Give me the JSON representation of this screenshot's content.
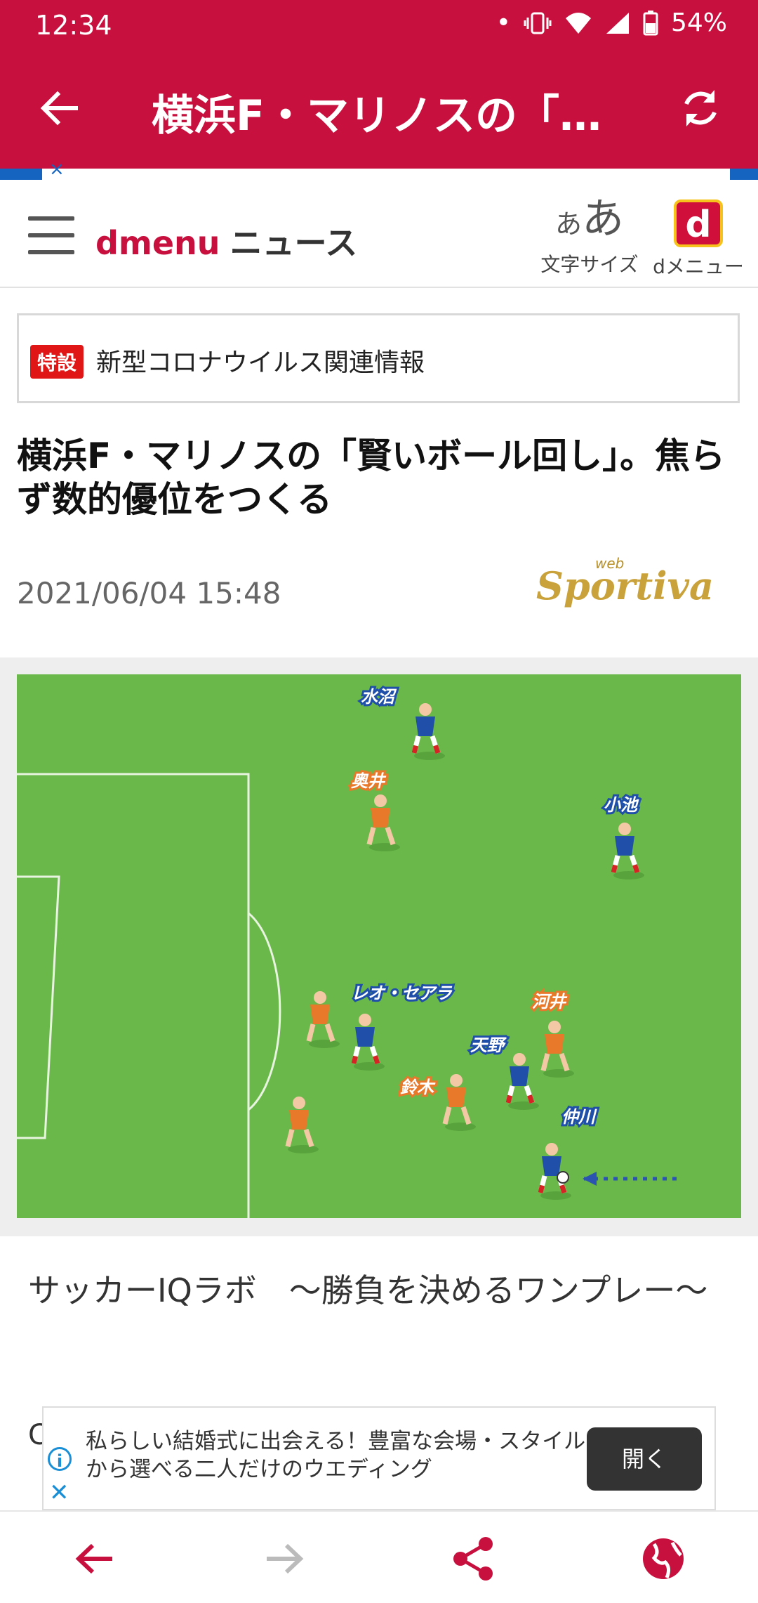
{
  "status_bar": {
    "time": "12:34",
    "battery": "54%",
    "icons": [
      "dot-icon",
      "vibrate-icon",
      "wifi-icon",
      "signal-icon",
      "battery-icon"
    ]
  },
  "app_bar": {
    "title": "横浜F・マリノスの「賢...",
    "back_icon": "back-arrow-icon",
    "refresh_icon": "refresh-icon"
  },
  "header": {
    "logo_d": "dmenu",
    "logo_news": "ニュース",
    "fontsize_glyph_small": "あ",
    "fontsize_glyph_large": "あ",
    "fontsize_label": "文字サイズ",
    "dmenu_label": "dメニュー",
    "dmenu_box": "d"
  },
  "notice": {
    "badge": "特設",
    "text": "新型コロナウイルス関連情報"
  },
  "article": {
    "headline": "横浜F・マリノスの「賢いボール回し」。焦らず数的優位をつくる",
    "date": "2021/06/04 15:48",
    "source_web": "web",
    "source_name": "Sportiva",
    "caption": "サッカーIQラボ　〜勝負を決めるワンプレー〜",
    "cut_text": "C"
  },
  "figure_labels": {
    "mizunuma": "水沼",
    "okui": "奥井",
    "koike": "小池",
    "leo": "レオ・セアラ",
    "kawai": "河井",
    "amano": "天野",
    "suzuki": "鈴木",
    "nakagawa": "仲川"
  },
  "ad": {
    "text": "私らしい結婚式に出会える！豊富な会場・スタイルから選べる二人だけのウエディング",
    "button": "開く",
    "info_icon": "info-icon",
    "close_icon": "close-icon"
  },
  "nav": {
    "icons": [
      "back-arrow-icon",
      "forward-arrow-icon",
      "share-icon",
      "globe-icon"
    ]
  },
  "colors": {
    "brand": "#c8103e",
    "field": "#6ab84a",
    "blue_player": "#1f4fa8",
    "orange_player": "#e8782a"
  }
}
